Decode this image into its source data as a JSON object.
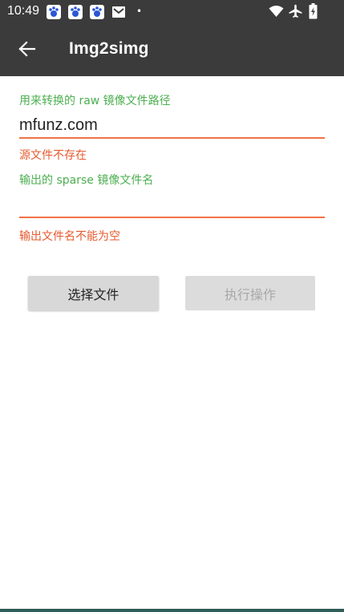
{
  "status_bar": {
    "time": "10:49",
    "notification_icons": [
      "baidu-paw-icon",
      "baidu-paw-icon",
      "baidu-paw-icon",
      "mail-icon"
    ],
    "dot": "•",
    "right_icons": [
      "wifi-icon",
      "airplane-icon",
      "battery-charging-icon"
    ]
  },
  "app_bar": {
    "back_icon": "arrow-left-icon",
    "title": "Img2simg"
  },
  "form": {
    "source": {
      "label": "用来转换的 raw 镜像文件路径",
      "value": "mfunz.com",
      "error": "源文件不存在"
    },
    "output": {
      "label": "输出的 sparse 镜像文件名",
      "value": "",
      "error": "输出文件名不能为空"
    }
  },
  "buttons": {
    "select_file": "选择文件",
    "execute": "执行操作"
  },
  "colors": {
    "bar": "#3b3b3b",
    "label_green": "#4caf50",
    "error_orange": "#e65a2e",
    "underline": "#f07246"
  }
}
